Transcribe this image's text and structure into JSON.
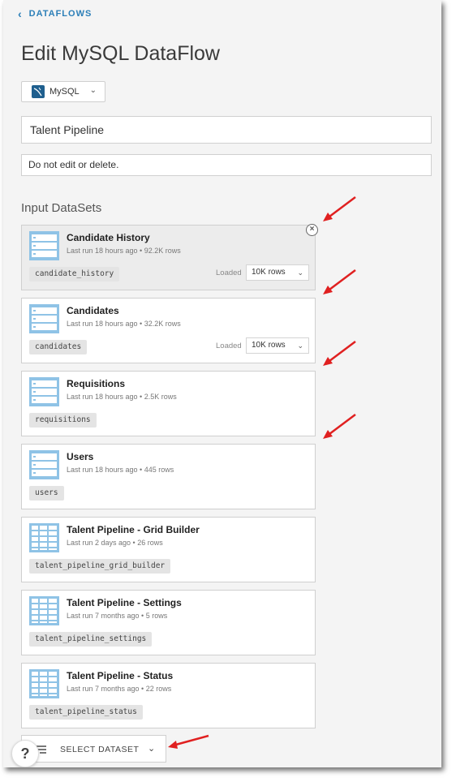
{
  "breadcrumb": {
    "label": "DATAFLOWS"
  },
  "page_title": "Edit MySQL DataFlow",
  "connector": {
    "label": "MySQL",
    "icon": "mysql-logo-icon"
  },
  "dataflow_name": {
    "value": "Talent Pipeline"
  },
  "dataflow_description": {
    "value": "Do not edit or delete."
  },
  "input_section_title": "Input DataSets",
  "datasets": [
    {
      "name": "Candidate History",
      "meta": "Last run 18 hours ago • 92.2K rows",
      "tag": "candidate_history",
      "loaded_label": "Loaded",
      "rows_value": "10K rows",
      "icon": "table-list-icon"
    },
    {
      "name": "Candidates",
      "meta": "Last run 18 hours ago • 32.2K rows",
      "tag": "candidates",
      "loaded_label": "Loaded",
      "rows_value": "10K rows",
      "icon": "table-list-icon"
    },
    {
      "name": "Requisitions",
      "meta": "Last run 18 hours ago • 2.5K rows",
      "tag": "requisitions",
      "icon": "table-list-icon"
    },
    {
      "name": "Users",
      "meta": "Last run 18 hours ago • 445 rows",
      "tag": "users",
      "icon": "table-list-icon"
    },
    {
      "name": "Talent Pipeline - Grid Builder",
      "meta": "Last run 2 days ago • 26 rows",
      "tag": "talent_pipeline_grid_builder",
      "icon": "table-grid-icon"
    },
    {
      "name": "Talent Pipeline - Settings",
      "meta": "Last run 7 months ago • 5 rows",
      "tag": "talent_pipeline_settings",
      "icon": "table-grid-icon"
    },
    {
      "name": "Talent Pipeline - Status",
      "meta": "Last run 7 months ago • 22 rows",
      "tag": "talent_pipeline_status",
      "icon": "table-grid-icon"
    }
  ],
  "select_dataset": {
    "label": "SELECT DATASET"
  },
  "help": {
    "label": "?"
  },
  "colors": {
    "accent": "#2c7fb8",
    "annotation_arrow": "#e02020",
    "dataset_icon": "#8fc3e6"
  }
}
